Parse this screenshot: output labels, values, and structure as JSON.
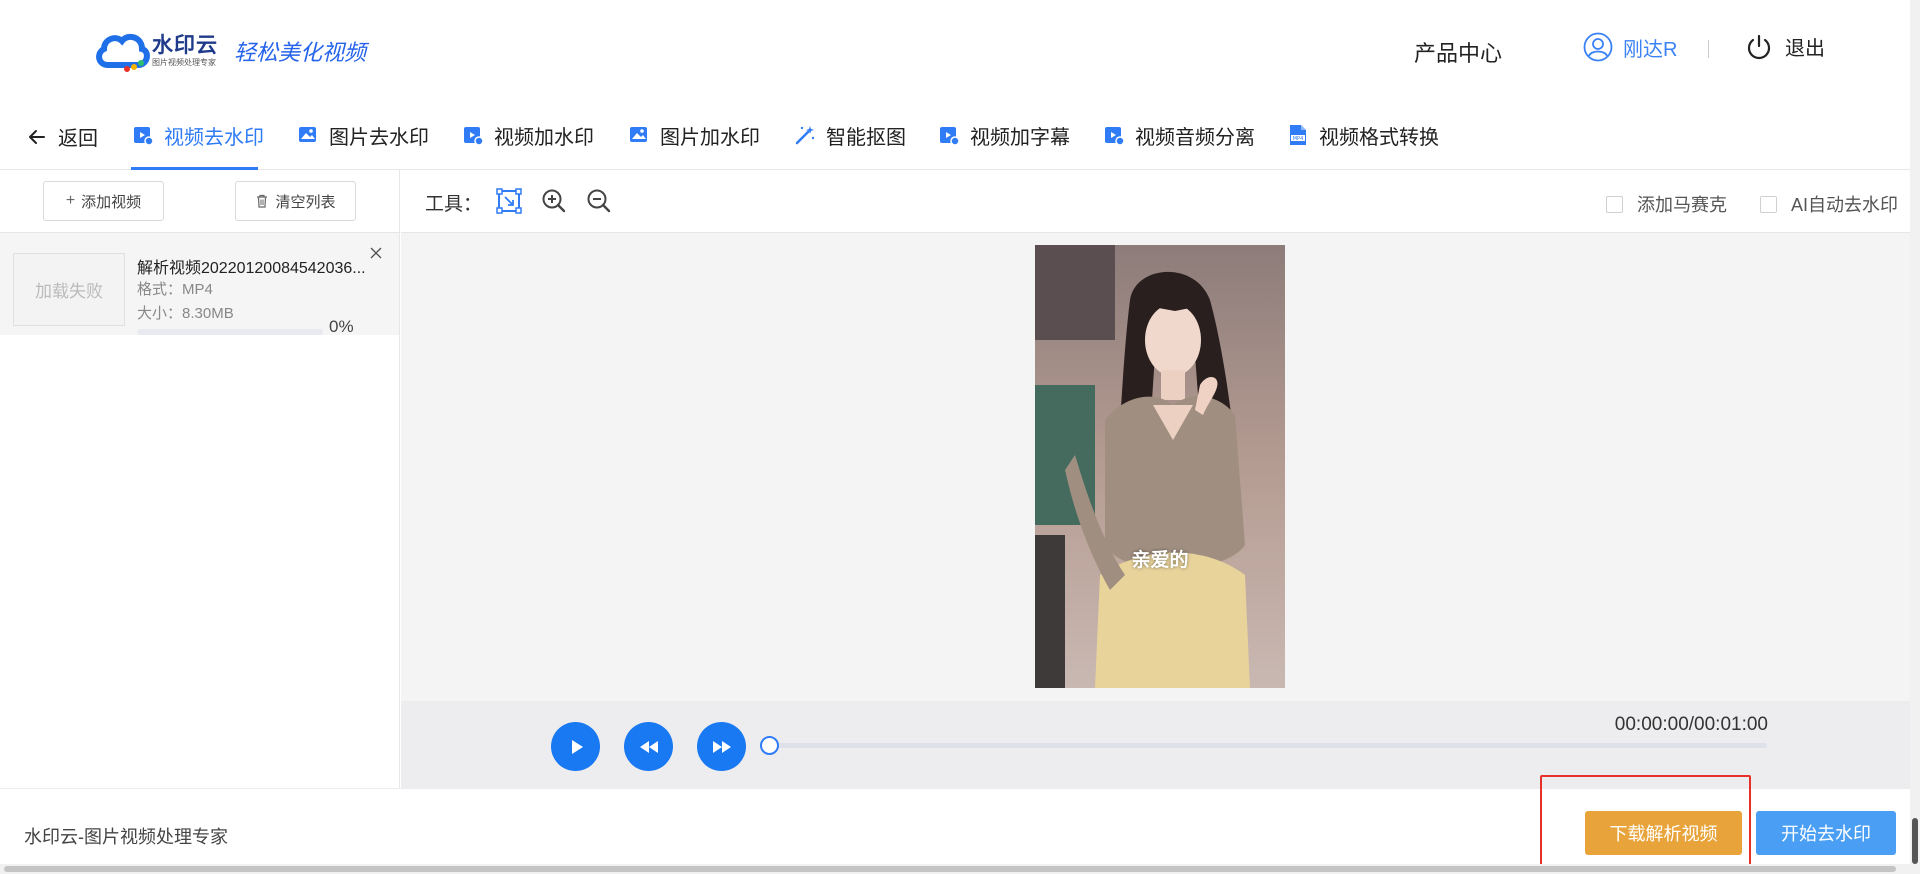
{
  "header": {
    "logo_name": "水印云",
    "logo_sub": "图片视频处理专家",
    "slogan": "轻松美化视频",
    "product_center": "产品中心",
    "username": "刚达R",
    "logout": "退出"
  },
  "tabs": {
    "back": "返回",
    "items": [
      {
        "label": "视频去水印",
        "icon": "video-icon",
        "active": true
      },
      {
        "label": "图片去水印",
        "icon": "image-icon",
        "active": false
      },
      {
        "label": "视频加水印",
        "icon": "video-icon",
        "active": false
      },
      {
        "label": "图片加水印",
        "icon": "image-icon",
        "active": false
      },
      {
        "label": "智能抠图",
        "icon": "magic-wand-icon",
        "active": false
      },
      {
        "label": "视频加字幕",
        "icon": "video-icon",
        "active": false
      },
      {
        "label": "视频音频分离",
        "icon": "video-icon",
        "active": false
      },
      {
        "label": "视频格式转换",
        "icon": "mp4-file-icon",
        "active": false
      }
    ]
  },
  "left_panel": {
    "add_video": "添加视频",
    "clear_list": "清空列表",
    "file": {
      "thumb_status": "加载失败",
      "name": "解析视频20220120084542036...",
      "format": "格式：MP4",
      "size": "大小：8.30MB",
      "progress_percent": 0,
      "progress_label": "0%"
    }
  },
  "editor": {
    "tools_label": "工具：",
    "tools": [
      "select-region-icon",
      "zoom-in-icon",
      "zoom-out-icon"
    ],
    "add_mosaic": "添加马赛克",
    "ai_auto_remove": "AI自动去水印",
    "caption": "亲爱的",
    "timecode": "00:00:00/00:01:00",
    "playback_progress": 0
  },
  "footer": {
    "brand": "水印云-图片视频处理专家",
    "download_button": "下载解析视频",
    "start_button": "开始去水印"
  },
  "colors": {
    "accent": "#2f7cf6",
    "orange": "#e8a43b",
    "highlight": "#e8302a"
  }
}
